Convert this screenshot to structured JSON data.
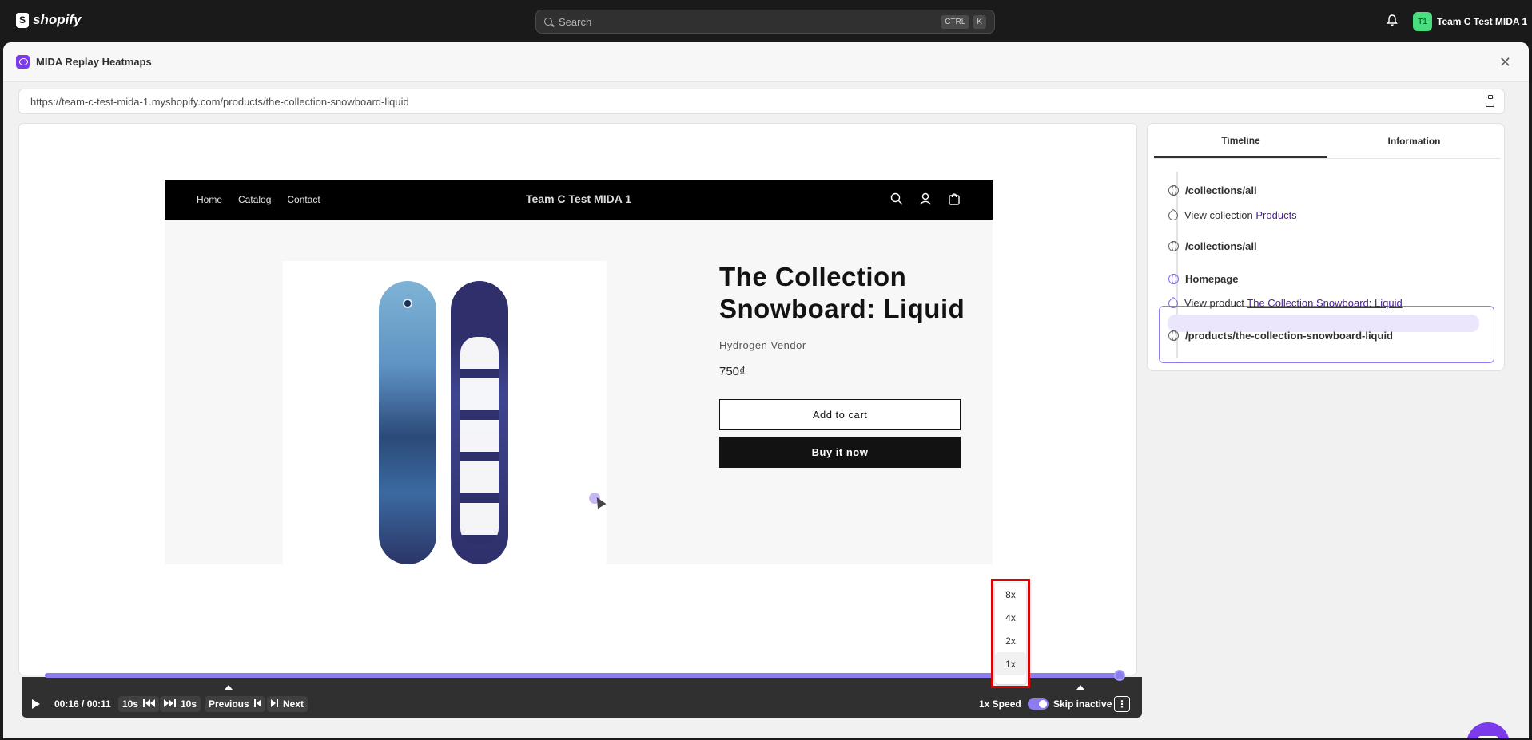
{
  "shopify": {
    "brand": "shopify",
    "search_placeholder": "Search",
    "shortcut_ctrl": "CTRL",
    "shortcut_k": "K",
    "user_initials": "T1",
    "user_name": "Team C Test MIDA 1"
  },
  "app": {
    "title": "MIDA Replay Heatmaps",
    "url": "https://team-c-test-mida-1.myshopify.com/products/the-collection-snowboard-liquid"
  },
  "store": {
    "nav_links": [
      "Home",
      "Catalog",
      "Contact"
    ],
    "name": "Team C Test MIDA 1",
    "product_title": "The Collection Snowboard: Liquid",
    "vendor": "Hydrogen Vendor",
    "price": "750₫",
    "add_to_cart": "Add to cart",
    "buy_now": "Buy it now"
  },
  "speed_menu": {
    "options": [
      "8x",
      "4x",
      "2x",
      "1x"
    ],
    "selected": "1x"
  },
  "controls": {
    "time": "00:16 / 00:11",
    "back_label": "10s",
    "fwd_label": "10s",
    "previous": "Previous",
    "next": "Next",
    "speed": "1x Speed",
    "skip_inactive": "Skip inactive",
    "skip_inactive_on": true,
    "progress_fraction": 1.0
  },
  "panel": {
    "tabs": [
      "Timeline",
      "Information"
    ],
    "active_tab": "Timeline",
    "timeline": [
      {
        "type": "page",
        "text": "/collections/all"
      },
      {
        "type": "event",
        "prefix": "View collection ",
        "link": "Products"
      },
      {
        "type": "page",
        "text": "/collections/all"
      },
      {
        "type": "page",
        "text": "Homepage",
        "highlighted": true
      },
      {
        "type": "event",
        "prefix": "View product ",
        "link": "The Collection Snowboard: Liquid",
        "highlighted": true
      },
      {
        "type": "page",
        "text": "/products/the-collection-snowboard-liquid"
      }
    ]
  },
  "colors": {
    "accent": "#8b7cf0",
    "highlight_border": "#e00000",
    "chat": "#7c3aed"
  }
}
